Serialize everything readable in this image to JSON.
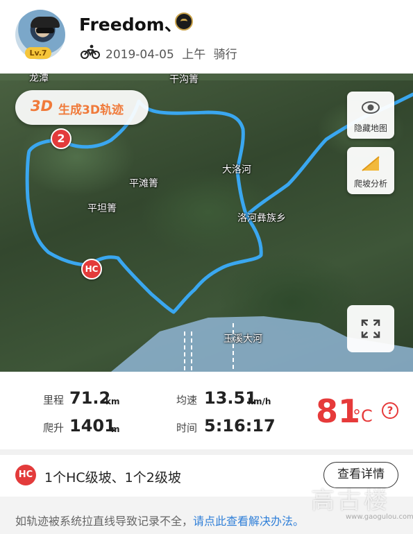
{
  "header": {
    "username": "Freedom、",
    "level": "Lv.7",
    "date": "2019-04-05",
    "time_of_day": "上午",
    "activity_type": "骑行",
    "activity_icon": "bicycle-icon"
  },
  "map": {
    "btn_3d_tag": "3D",
    "btn_3d_label": "生成3D轨迹",
    "hide_map_label": "隐藏地图",
    "climb_analysis_label": "爬坡分析",
    "places": {
      "p1": "龙潭",
      "p2": "干沟箐",
      "p3": "大洛河",
      "p4": "平滩箐",
      "p5": "平坦箐",
      "p6": "洛河彝族乡",
      "p7": "玉溪大河"
    },
    "marker_2": "2",
    "marker_hc": "HC",
    "route_color": "#3aa7f0"
  },
  "stats": {
    "distance_label": "里程",
    "distance_value": "71.2",
    "distance_unit": "km",
    "speed_label": "均速",
    "speed_value": "13.51",
    "speed_unit": "km/h",
    "climb_label": "爬升",
    "climb_value": "1401",
    "climb_unit": "m",
    "time_label": "时间",
    "time_value": "5:16:17",
    "temperature_value": "81",
    "temperature_unit": "°C",
    "help_symbol": "?"
  },
  "climb_summary": {
    "badge": "HC",
    "text": "1个HC级坡、1个2级坡",
    "detail_button": "查看详情"
  },
  "notice": {
    "text": "如轨迹被系统拉直线导致记录不全，",
    "link": "请点此查看解决办法。"
  },
  "watermark": {
    "text": "高古楼",
    "sub": "www.gaogulou.com"
  },
  "colors": {
    "accent_orange": "#f07a3a",
    "temperature_red": "#e63a3a",
    "link_blue": "#2f7fd8"
  }
}
